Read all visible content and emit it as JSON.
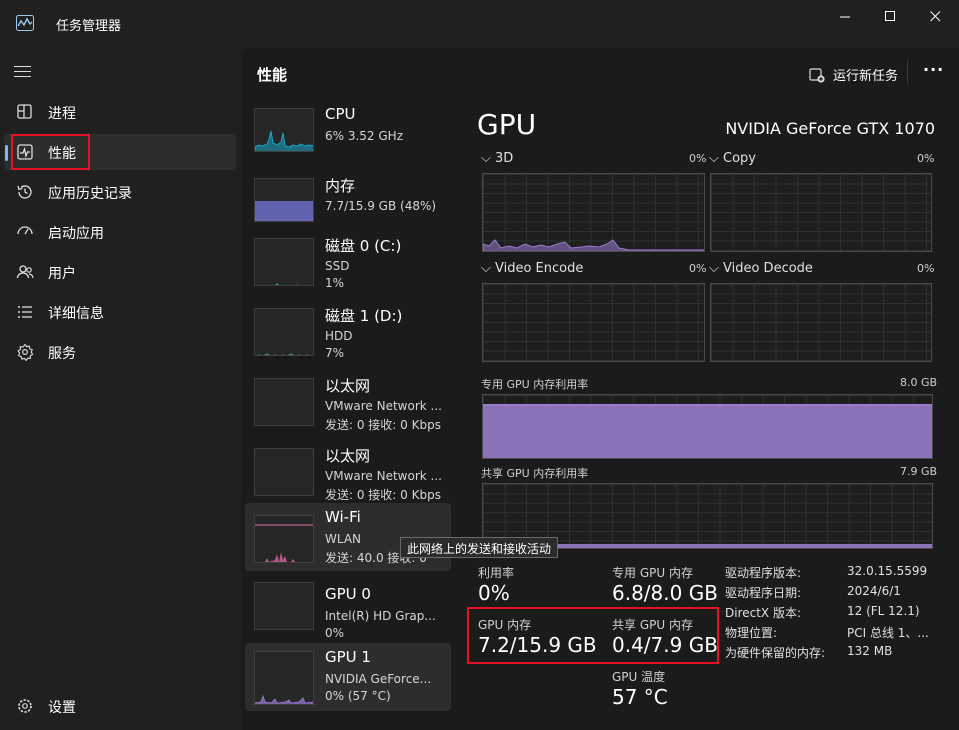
{
  "window": {
    "title": "任务管理器"
  },
  "sidebar": {
    "items": [
      {
        "label": "进程",
        "icon": "processes-icon"
      },
      {
        "label": "性能",
        "icon": "performance-icon"
      },
      {
        "label": "应用历史记录",
        "icon": "history-icon"
      },
      {
        "label": "启动应用",
        "icon": "startup-icon"
      },
      {
        "label": "用户",
        "icon": "users-icon"
      },
      {
        "label": "详细信息",
        "icon": "details-icon"
      },
      {
        "label": "服务",
        "icon": "services-icon"
      }
    ],
    "active_index": 1,
    "settings_label": "设置"
  },
  "header": {
    "title": "性能",
    "run_task_label": "运行新任务",
    "more_label": "···"
  },
  "resources": [
    {
      "name": "CPU",
      "line1": "6% 3.52 GHz",
      "line2": "",
      "color": "#17a6c7"
    },
    {
      "name": "内存",
      "line1": "7.7/15.9 GB (48%)",
      "line2": "",
      "color": "#6b70c9"
    },
    {
      "name": "磁盘 0 (C:)",
      "line1": "SSD",
      "line2": "1%",
      "color": "#3aa58a"
    },
    {
      "name": "磁盘 1 (D:)",
      "line1": "HDD",
      "line2": "7%",
      "color": "#3aa58a"
    },
    {
      "name": "以太网",
      "line1": "VMware Network ...",
      "line2": "发送: 0 接收: 0 Kbps",
      "color": "#c75a93"
    },
    {
      "name": "以太网",
      "line1": "VMware Network ...",
      "line2": "发送: 0 接收: 0 Kbps",
      "color": "#c75a93"
    },
    {
      "name": "Wi-Fi",
      "line1": "WLAN",
      "line2": "发送: 40.0 接收: 0",
      "color": "#e36aaa"
    },
    {
      "name": "GPU 0",
      "line1": "Intel(R) HD Grap...",
      "line2": "0%",
      "color": "#9a7bd1"
    },
    {
      "name": "GPU 1",
      "line1": "NVIDIA GeForce...",
      "line2": "0% (57 °C)",
      "color": "#9a7bd1"
    }
  ],
  "tooltip": "此网络上的发送和接收活动",
  "detail": {
    "title": "GPU",
    "model": "NVIDIA GeForce GTX 1070",
    "engines": [
      {
        "label": "3D",
        "pct": "0%"
      },
      {
        "label": "Copy",
        "pct": "0%"
      },
      {
        "label": "Video Encode",
        "pct": "0%"
      },
      {
        "label": "Video Decode",
        "pct": "0%"
      }
    ],
    "dedicated_graph": {
      "label": "专用 GPU 内存利用率",
      "max": "8.0 GB",
      "fill": 0.85
    },
    "shared_graph": {
      "label": "共享 GPU 内存利用率",
      "max": "7.9 GB",
      "fill": 0.05
    },
    "stats": {
      "utilization_label": "利用率",
      "utilization": "0%",
      "dedicated_label": "专用 GPU 内存",
      "dedicated": "6.8/8.0 GB",
      "gpu_mem_label": "GPU 内存",
      "gpu_mem": "7.2/15.9 GB",
      "shared_label": "共享 GPU 内存",
      "shared": "0.4/7.9 GB",
      "temp_label": "GPU 温度",
      "temp": "57 °C"
    },
    "info": [
      {
        "k": "驱动程序版本:",
        "v": "32.0.15.5599"
      },
      {
        "k": "驱动程序日期:",
        "v": "2024/6/1"
      },
      {
        "k": "DirectX 版本:",
        "v": "12 (FL 12.1)"
      },
      {
        "k": "物理位置:",
        "v": "PCI 总线 1、..."
      },
      {
        "k": "为硬件保留的内存:",
        "v": "132 MB"
      }
    ]
  },
  "colors": {
    "accent": "#76b9ed",
    "highlight": "#e81123",
    "gpu_purple": "#9a7bd1"
  }
}
